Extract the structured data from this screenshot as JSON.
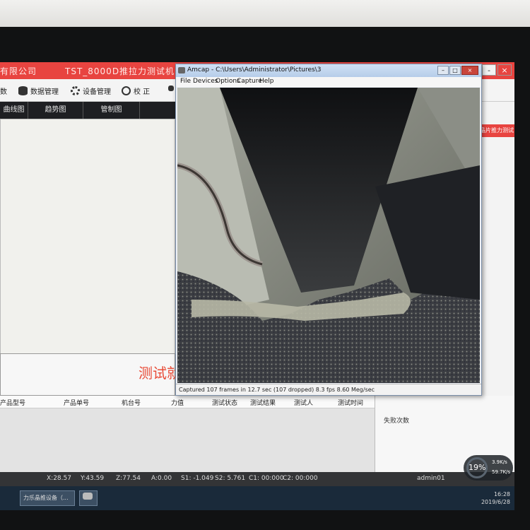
{
  "app": {
    "company": "有限公司",
    "title": "TST_8000D推拉力测试机",
    "win_min": "-",
    "win_close": "×"
  },
  "toolbar": {
    "item_0": "数",
    "data_mgmt": "数据管理",
    "device_mgmt": "设备管理",
    "calibrate": "校 正"
  },
  "tabs": [
    "曲线图",
    "趋势图",
    "管制图"
  ],
  "ready_text": "测试就",
  "right_panel": {
    "push_test": "晶片推力测试"
  },
  "grid": {
    "columns": [
      "产品型号",
      "产品单号",
      "机台号",
      "力值",
      "测试状态",
      "测试结果",
      "测试人",
      "测试时间"
    ]
  },
  "side_panel": {
    "fail_count_label": "失败次数"
  },
  "status": {
    "x": "X:28.57",
    "y": "Y:43.59",
    "z": "Z:77.54",
    "a": "A:0.00",
    "s1": "S1: -1.049",
    "s2": "S2: 5.761",
    "c1": "C1: 00:000",
    "c2": "C2: 00:000",
    "user": "admin01"
  },
  "taskbar": {
    "task1": "力乐晶推设备（...",
    "time": "16:28",
    "date": "2019/6/28"
  },
  "gauge": {
    "percent": "19%",
    "up": "3.9K/s",
    "down": "59.7K/s"
  },
  "amcap": {
    "title": "Amcap - C:\\Users\\Administrator\\Pictures\\3",
    "menu": [
      "File",
      "Devices",
      "Options",
      "Capture",
      "Help"
    ],
    "status": "Captured 107 frames in 12.7 sec (107 dropped) 8.3 fps 8.60 Meg/sec"
  }
}
